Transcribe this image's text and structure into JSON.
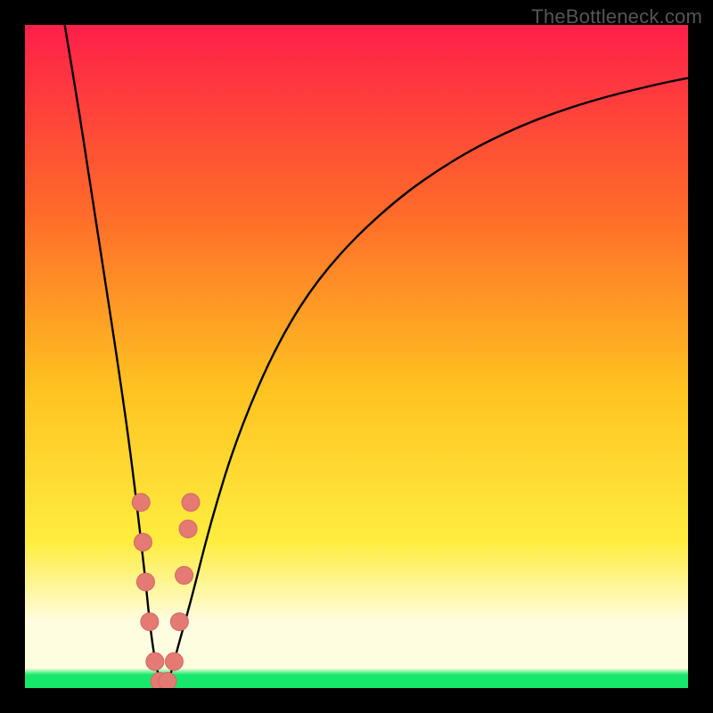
{
  "watermark": "TheBottleneck.com",
  "colors": {
    "top": "#ff1f4a",
    "upper_mid": "#ff6a2a",
    "mid": "#ffc321",
    "lower_mid": "#ffed40",
    "pale": "#fffde0",
    "green": "#17e86b",
    "curve": "#000000",
    "marker_fill": "#e47a73",
    "marker_stroke": "#cf6a63"
  },
  "chart_data": {
    "type": "line",
    "title": "",
    "xlabel": "",
    "ylabel": "",
    "xlim": [
      0,
      100
    ],
    "ylim": [
      0,
      100
    ],
    "notes": "Bottleneck-style chart. Y ≈ percent penalty (100=red at top, 0=green at bottom). X is component sweep. No numeric tick labels shown; values estimated from pixel positions.",
    "series": [
      {
        "name": "curve",
        "x": [
          6,
          8,
          10,
          12,
          14,
          16,
          18,
          19,
          20,
          21,
          22,
          23,
          25,
          28,
          32,
          38,
          45,
          55,
          65,
          75,
          85,
          95,
          100
        ],
        "values": [
          100,
          88,
          75,
          62,
          49,
          35,
          18,
          8,
          2,
          0,
          2,
          6,
          13,
          25,
          38,
          52,
          63,
          73,
          80,
          85,
          88.5,
          91,
          92
        ]
      }
    ],
    "markers": [
      {
        "x": 17.5,
        "y": 28
      },
      {
        "x": 17.8,
        "y": 22
      },
      {
        "x": 18.2,
        "y": 16
      },
      {
        "x": 18.8,
        "y": 10
      },
      {
        "x": 19.6,
        "y": 4
      },
      {
        "x": 20.3,
        "y": 1
      },
      {
        "x": 21.5,
        "y": 1
      },
      {
        "x": 22.5,
        "y": 4
      },
      {
        "x": 23.3,
        "y": 10
      },
      {
        "x": 24.0,
        "y": 17
      },
      {
        "x": 24.6,
        "y": 24
      },
      {
        "x": 25.0,
        "y": 28
      }
    ],
    "marker_radius": 10
  }
}
